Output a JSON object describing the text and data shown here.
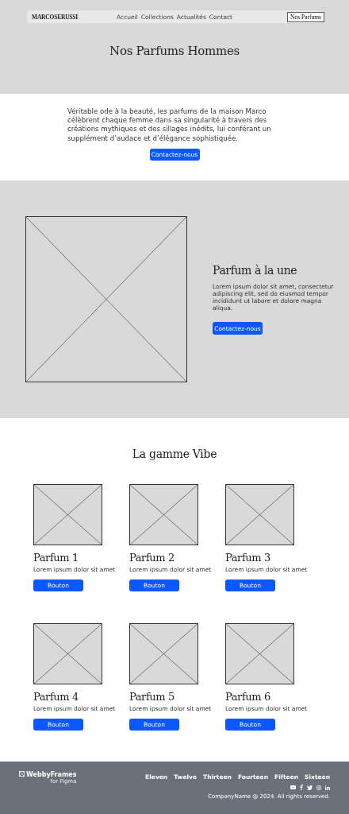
{
  "nav": {
    "logo": "MARCOSERUSSI",
    "links": [
      "Accueil",
      "Collections",
      "Actualités",
      "Contact"
    ],
    "button": "Nos Parfums"
  },
  "hero": {
    "title": "Nos Parfums Hommes"
  },
  "intro": {
    "text": "Véritable ode à la beauté, les parfums de la maison Marco célèbrent chaque femme dans sa singularité à travers des créations mythiques et des sillages inédits, lui conférant un supplément d’audace et d’élégance sophistiquée.",
    "button": "Contactez-nous"
  },
  "featured": {
    "title": "Parfum à la une",
    "text": "Lorem ipsum dolor sit amet, consectetur adipiscing elit, sed do eiusmod tempor incididunt ut labore et dolore magna aliqua.",
    "button": "Contactez-nous"
  },
  "range": {
    "title": "La gamme Vibe",
    "products": [
      {
        "name": "Parfum 1",
        "description": "Lorem ipsum dolor sit amet",
        "button": "Bouton"
      },
      {
        "name": "Parfum 2",
        "description": "Lorem ipsum dolor sit amet",
        "button": "Bouton"
      },
      {
        "name": "Parfum 3",
        "description": "Lorem ipsum dolor sit amet",
        "button": "Bouton"
      },
      {
        "name": "Parfum 4",
        "description": "Lorem ipsum dolor sit amet",
        "button": "Bouton"
      },
      {
        "name": "Parfum 5",
        "description": "Lorem ipsum dolor sit amet",
        "button": "Bouton"
      },
      {
        "name": "Parfum 6",
        "description": "Lorem ipsum dolor sit amet",
        "button": "Bouton"
      }
    ]
  },
  "footer": {
    "logo": "WebbyFrames",
    "logo_sub": "for Figma",
    "links": [
      "Eleven",
      "Twelve",
      "Thirteen",
      "Fourteen",
      "Fifteen",
      "Sixteen"
    ],
    "copyright": "CompanyName @ 2024. All rights reserved."
  }
}
